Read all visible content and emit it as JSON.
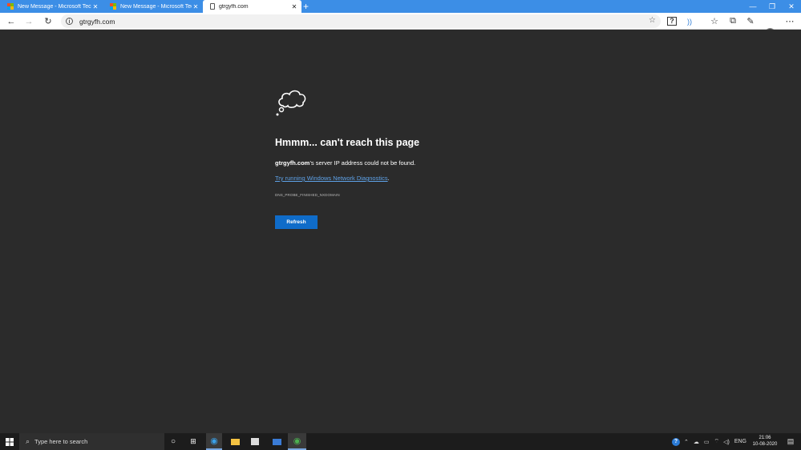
{
  "tabs": [
    {
      "title": "New Message - Microsoft Tech C",
      "active": false
    },
    {
      "title": "New Message - Microsoft Tech C",
      "active": false
    },
    {
      "title": "gtrgyfh.com",
      "active": true
    }
  ],
  "new_tab_icon": "plus-icon",
  "address_bar": {
    "url": "gtrgyfh.com"
  },
  "error_page": {
    "heading": "Hmmm... can't reach this page",
    "domain": "gtrgyfh.com",
    "message_suffix": "’s server IP address could not be found.",
    "diagnostics_link": "Try running Windows Network Diagnostics",
    "diagnostics_suffix": ".",
    "error_code": "DNS_PROBE_FINISHED_NXDOMAIN",
    "refresh_label": "Refresh"
  },
  "taskbar": {
    "search_placeholder": "Type here to search",
    "language": "ENG",
    "time": "21:06",
    "date": "10-08-2020"
  },
  "colors": {
    "tab_strip": "#3c8ee6",
    "page_background": "#2b2b2b",
    "refresh_button": "#0f6cc9",
    "link": "#5ea2e8",
    "taskbar": "#1c1c1c"
  }
}
